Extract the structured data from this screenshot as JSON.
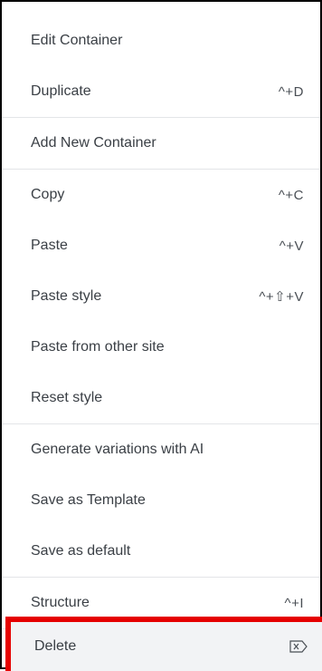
{
  "menu": {
    "groups": [
      {
        "items": [
          {
            "label": "Edit Container",
            "shortcut": ""
          },
          {
            "label": "Duplicate",
            "shortcut": "^+D"
          }
        ]
      },
      {
        "items": [
          {
            "label": "Add New Container",
            "shortcut": ""
          }
        ]
      },
      {
        "items": [
          {
            "label": "Copy",
            "shortcut": "^+C"
          },
          {
            "label": "Paste",
            "shortcut": "^+V"
          },
          {
            "label": "Paste style",
            "shortcut": "^+⇧+V"
          },
          {
            "label": "Paste from other site",
            "shortcut": ""
          },
          {
            "label": "Reset style",
            "shortcut": ""
          }
        ]
      },
      {
        "items": [
          {
            "label": "Generate variations with AI",
            "shortcut": ""
          },
          {
            "label": "Save as Template",
            "shortcut": ""
          },
          {
            "label": "Save as default",
            "shortcut": ""
          }
        ]
      },
      {
        "items": [
          {
            "label": "Structure",
            "shortcut": "^+I"
          }
        ]
      }
    ],
    "delete": {
      "label": "Delete",
      "icon": "backspace-icon"
    }
  },
  "colors": {
    "highlight_border": "#e50000",
    "hover_bg": "#f2f3f5",
    "text": "#3a3f45",
    "divider": "#e3e5e8"
  }
}
